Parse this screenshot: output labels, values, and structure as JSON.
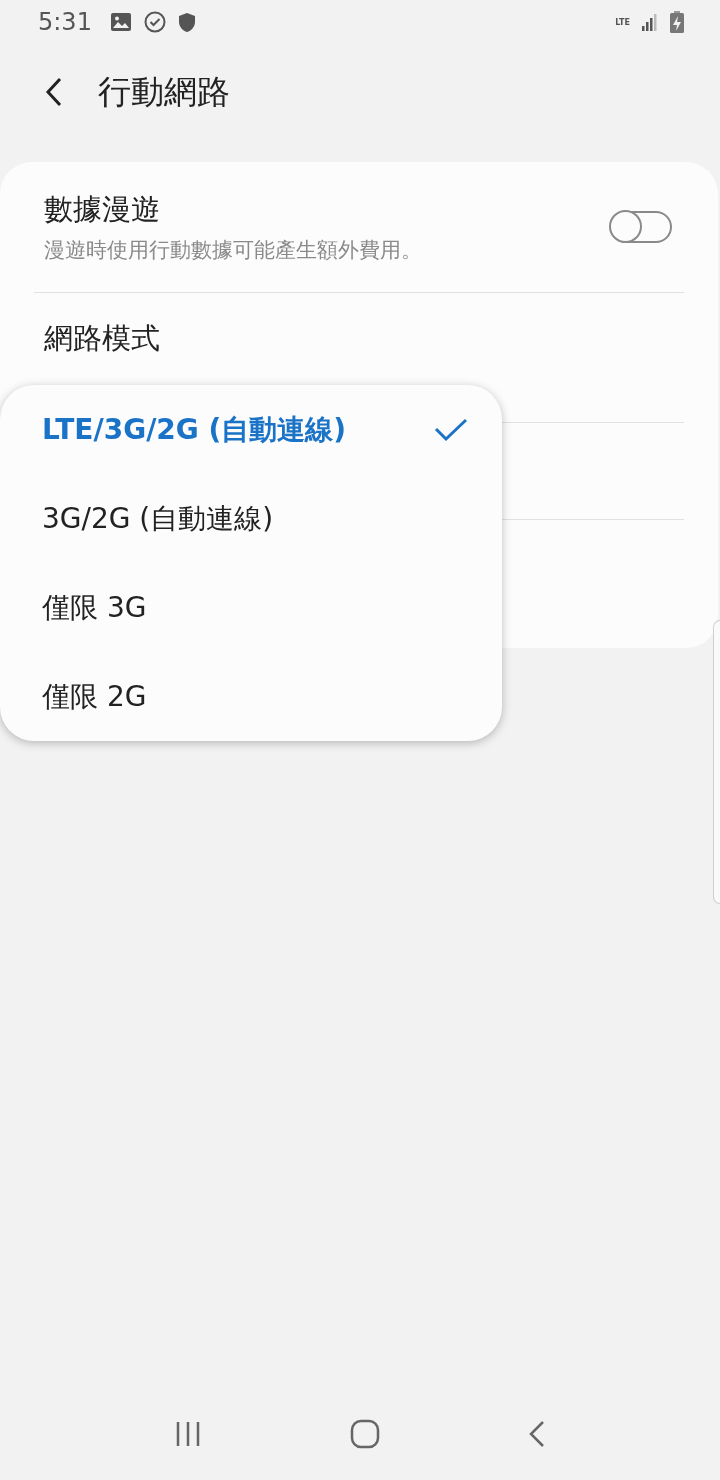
{
  "status_bar": {
    "time": "5:31",
    "network": "LTE"
  },
  "header": {
    "title": "行動網路"
  },
  "settings": [
    {
      "kind": "toggle",
      "title": "數據漫遊",
      "subtitle": "漫遊時使用行動數據可能產生額外費用。",
      "on": false
    },
    {
      "kind": "value",
      "title": "網路模式"
    },
    {
      "kind": "empty"
    },
    {
      "kind": "empty"
    }
  ],
  "popup": {
    "options": [
      {
        "label": "LTE/3G/2G (自動連線)",
        "selected": true
      },
      {
        "label": "3G/2G (自動連線)",
        "selected": false
      },
      {
        "label": "僅限 3G",
        "selected": false
      },
      {
        "label": "僅限 2G",
        "selected": false
      }
    ]
  }
}
